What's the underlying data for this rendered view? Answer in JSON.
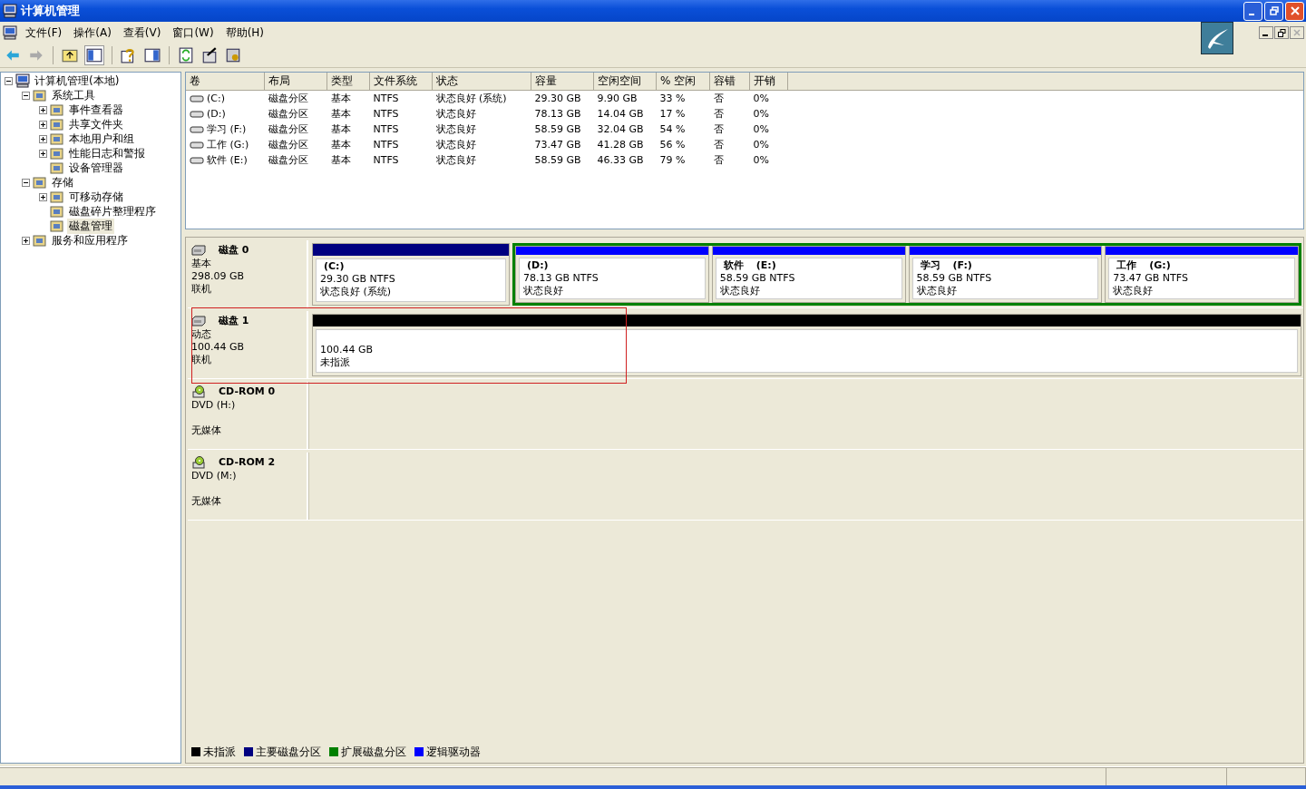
{
  "window": {
    "title": "计算机管理"
  },
  "menu": [
    "文件(F)",
    "操作(A)",
    "查看(V)",
    "窗口(W)",
    "帮助(H)"
  ],
  "tree": [
    {
      "label": "计算机管理(本地)",
      "selected": false,
      "expanded": true,
      "children": [
        {
          "label": "系统工具",
          "selected": false,
          "expanded": true,
          "children": [
            {
              "label": "事件查看器",
              "selected": false,
              "expanded": false
            },
            {
              "label": "共享文件夹",
              "selected": false,
              "expanded": false
            },
            {
              "label": "本地用户和组",
              "selected": false,
              "expanded": false
            },
            {
              "label": "性能日志和警报",
              "selected": false,
              "expanded": false
            },
            {
              "label": "设备管理器",
              "selected": false
            }
          ]
        },
        {
          "label": "存储",
          "selected": false,
          "expanded": true,
          "children": [
            {
              "label": "可移动存储",
              "selected": false,
              "expanded": false
            },
            {
              "label": "磁盘碎片整理程序",
              "selected": false
            },
            {
              "label": "磁盘管理",
              "selected": true
            }
          ]
        },
        {
          "label": "服务和应用程序",
          "selected": false,
          "expanded": false
        }
      ]
    }
  ],
  "volumes": {
    "columns": [
      "卷",
      "布局",
      "类型",
      "文件系统",
      "状态",
      "容量",
      "空闲空间",
      "% 空闲",
      "容错",
      "开销"
    ],
    "rows": [
      [
        "(C:)",
        "磁盘分区",
        "基本",
        "NTFS",
        "状态良好 (系统)",
        "29.30 GB",
        "9.90 GB",
        "33 %",
        "否",
        "0%"
      ],
      [
        "(D:)",
        "磁盘分区",
        "基本",
        "NTFS",
        "状态良好",
        "78.13 GB",
        "14.04 GB",
        "17 %",
        "否",
        "0%"
      ],
      [
        "学习 (F:)",
        "磁盘分区",
        "基本",
        "NTFS",
        "状态良好",
        "58.59 GB",
        "32.04 GB",
        "54 %",
        "否",
        "0%"
      ],
      [
        "工作 (G:)",
        "磁盘分区",
        "基本",
        "NTFS",
        "状态良好",
        "73.47 GB",
        "41.28 GB",
        "56 %",
        "否",
        "0%"
      ],
      [
        "软件 (E:)",
        "磁盘分区",
        "基本",
        "NTFS",
        "状态良好",
        "58.59 GB",
        "46.33 GB",
        "79 %",
        "否",
        "0%"
      ]
    ]
  },
  "disks": [
    {
      "kind": "disk",
      "name": "磁盘 0",
      "type": "基本",
      "size": "298.09 GB",
      "status": "联机",
      "partitions": [
        {
          "kind": "primary",
          "drive": "(C:)",
          "detail": "29.30 GB NTFS",
          "status": "状态良好 (系统)"
        },
        {
          "kind": "extended",
          "children": [
            {
              "kind": "logical",
              "drive": "(D:)",
              "detail": "78.13 GB NTFS",
              "status": "状态良好"
            },
            {
              "kind": "logical",
              "name": "软件",
              "drive": "(E:)",
              "detail": "58.59 GB NTFS",
              "status": "状态良好"
            },
            {
              "kind": "logical",
              "name": "学习",
              "drive": "(F:)",
              "detail": "58.59 GB NTFS",
              "status": "状态良好"
            },
            {
              "kind": "logical",
              "name": "工作",
              "drive": "(G:)",
              "detail": "73.47 GB NTFS",
              "status": "状态良好"
            }
          ]
        }
      ]
    },
    {
      "kind": "disk",
      "name": "磁盘 1",
      "type": "动态",
      "size": "100.44 GB",
      "status": "联机",
      "highlighted": true,
      "partitions": [
        {
          "kind": "unallocated",
          "detail": "100.44 GB",
          "status": "未指派"
        }
      ]
    },
    {
      "kind": "cdrom",
      "name": "CD-ROM 0",
      "type": "DVD (H:)",
      "status": "无媒体"
    },
    {
      "kind": "cdrom",
      "name": "CD-ROM 2",
      "type": "DVD (M:)",
      "status": "无媒体"
    }
  ],
  "legend": [
    {
      "label": "未指派",
      "color": "#000000"
    },
    {
      "label": "主要磁盘分区",
      "color": "#000080"
    },
    {
      "label": "扩展磁盘分区",
      "color": "#008000"
    },
    {
      "label": "逻辑驱动器",
      "color": "#0000ff"
    }
  ]
}
